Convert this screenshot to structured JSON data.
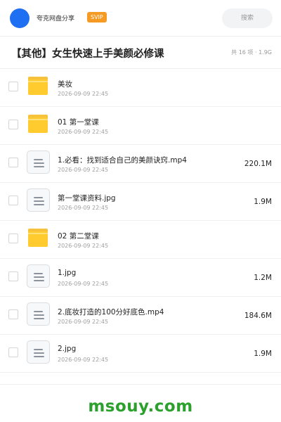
{
  "header": {
    "share_name": "夸克网盘分享",
    "badge": "SVIP",
    "search_label": "搜索",
    "avatar_color": "#1e6ff1",
    "badge_color": "#f59a23"
  },
  "title": {
    "text": "【其他】女生快速上手美颜必修课",
    "summary": "共 16 项 · 1.9G"
  },
  "files": [
    {
      "icon": "folder-icon",
      "name": "美妆",
      "date": "2026-09-09 22:45",
      "size": ""
    },
    {
      "icon": "folder-icon",
      "name": "01 第一堂课",
      "date": "2026-09-09 22:45",
      "size": ""
    },
    {
      "icon": "file-icon",
      "name": "1.必看：找到适合自己的美颜诀窍.mp4",
      "date": "2026-09-09 22:45",
      "size": "220.1M"
    },
    {
      "icon": "file-icon",
      "name": "第一堂课资料.jpg",
      "date": "2026-09-09 22:45",
      "size": "1.9M"
    },
    {
      "icon": "folder-icon",
      "name": "02 第二堂课",
      "date": "2026-09-09 22:45",
      "size": ""
    },
    {
      "icon": "file-icon",
      "name": "1.jpg",
      "date": "2026-09-09 22:45",
      "size": "1.2M"
    },
    {
      "icon": "file-icon",
      "name": "2.底妆打造的100分好底色.mp4",
      "date": "2026-09-09 22:45",
      "size": "184.6M"
    },
    {
      "icon": "file-icon",
      "name": "2.jpg",
      "date": "2026-09-09 22:45",
      "size": "1.9M"
    }
  ],
  "footer": {
    "watermark": "msouy.com",
    "watermark_color": "#2ca02c"
  }
}
